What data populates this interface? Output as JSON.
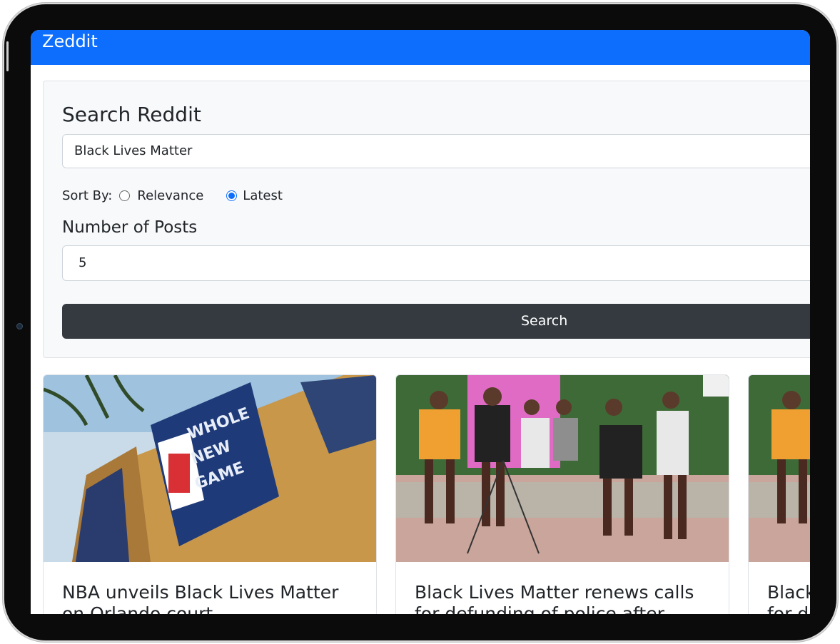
{
  "app": {
    "brand": "Zeddit"
  },
  "search": {
    "heading": "Search Reddit",
    "query_value": "Black Lives Matter",
    "sort_label": "Sort By:",
    "sort_options": [
      {
        "label": "Relevance",
        "selected": false
      },
      {
        "label": "Latest",
        "selected": true
      }
    ],
    "posts_label": "Number of Posts",
    "posts_value": "5",
    "button_label": "Search"
  },
  "results": [
    {
      "title": "NBA unveils Black Lives Matter on Orlando court"
    },
    {
      "title": "Black Lives Matter renews calls for defunding of police after charges"
    },
    {
      "title": "Black Lives Matter renews calls for defunding of police after charges"
    }
  ],
  "colors": {
    "primary": "#0d6efd",
    "dark": "#343a40"
  }
}
